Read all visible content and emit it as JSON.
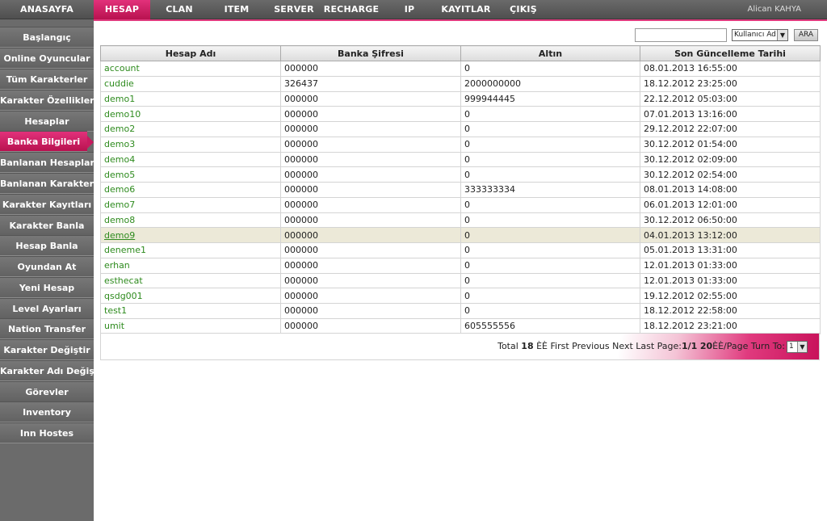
{
  "topnav": {
    "items": [
      "ANASAYFA",
      "HESAP",
      "CLAN",
      "ITEM",
      "SERVER",
      "RECHARGE",
      "IP",
      "KAYITLAR",
      "ÇIKIŞ"
    ],
    "active": "HESAP",
    "user": "Alican KAHYA"
  },
  "sidebar": {
    "items": [
      "Başlangıç",
      "Online Oyuncular",
      "Tüm Karakterler",
      "Karakter Özellikleri",
      "Hesaplar",
      "Banka Bilgileri",
      "Banlanan Hesaplar",
      "Banlanan Karakterler",
      "Karakter Kayıtları",
      "Karakter Banla",
      "Hesap Banla",
      "Oyundan At",
      "Yeni Hesap",
      "Level Ayarları",
      "Nation Transfer",
      "Karakter Değiştir",
      "Karakter Adı Değiştir",
      "Görevler",
      "Inventory",
      "Inn Hostes"
    ],
    "active": "Banka Bilgileri"
  },
  "search": {
    "value": "",
    "select_value": "Kullanıcı Ad",
    "button_label": "ARA"
  },
  "table": {
    "headers": [
      "Hesap Adı",
      "Banka Şifresi",
      "Altın",
      "Son Güncelleme Tarihi"
    ],
    "rows": [
      [
        "account",
        "000000",
        "0",
        "08.01.2013 16:55:00"
      ],
      [
        "cuddie",
        "326437",
        "2000000000",
        "18.12.2012 23:25:00"
      ],
      [
        "demo1",
        "000000",
        "999944445",
        "22.12.2012 05:03:00"
      ],
      [
        "demo10",
        "000000",
        "0",
        "07.01.2013 13:16:00"
      ],
      [
        "demo2",
        "000000",
        "0",
        "29.12.2012 22:07:00"
      ],
      [
        "demo3",
        "000000",
        "0",
        "30.12.2012 01:54:00"
      ],
      [
        "demo4",
        "000000",
        "0",
        "30.12.2012 02:09:00"
      ],
      [
        "demo5",
        "000000",
        "0",
        "30.12.2012 02:54:00"
      ],
      [
        "demo6",
        "000000",
        "333333334",
        "08.01.2013 14:08:00"
      ],
      [
        "demo7",
        "000000",
        "0",
        "06.01.2013 12:01:00"
      ],
      [
        "demo8",
        "000000",
        "0",
        "30.12.2012 06:50:00"
      ],
      [
        "demo9",
        "000000",
        "0",
        "04.01.2013 13:12:00"
      ],
      [
        "deneme1",
        "000000",
        "0",
        "05.01.2013 13:31:00"
      ],
      [
        "erhan",
        "000000",
        "0",
        "12.01.2013 01:33:00"
      ],
      [
        "esthecat",
        "000000",
        "0",
        "12.01.2013 01:33:00"
      ],
      [
        "qsdg001",
        "000000",
        "0",
        "19.12.2012 02:55:00"
      ],
      [
        "test1",
        "000000",
        "0",
        "18.12.2012 22:58:00"
      ],
      [
        "umit",
        "000000",
        "605555556",
        "18.12.2012 23:21:00"
      ]
    ],
    "highlighted_row": "demo9"
  },
  "pager": {
    "total_prefix": "Total",
    "total": "18",
    "after_total": "ÈÈ First Previous Next Last Page:",
    "page": "1/1",
    "per_page": "20",
    "after_per_page": "ÈÈ/Page Turn To:",
    "turn_to_value": "1"
  }
}
